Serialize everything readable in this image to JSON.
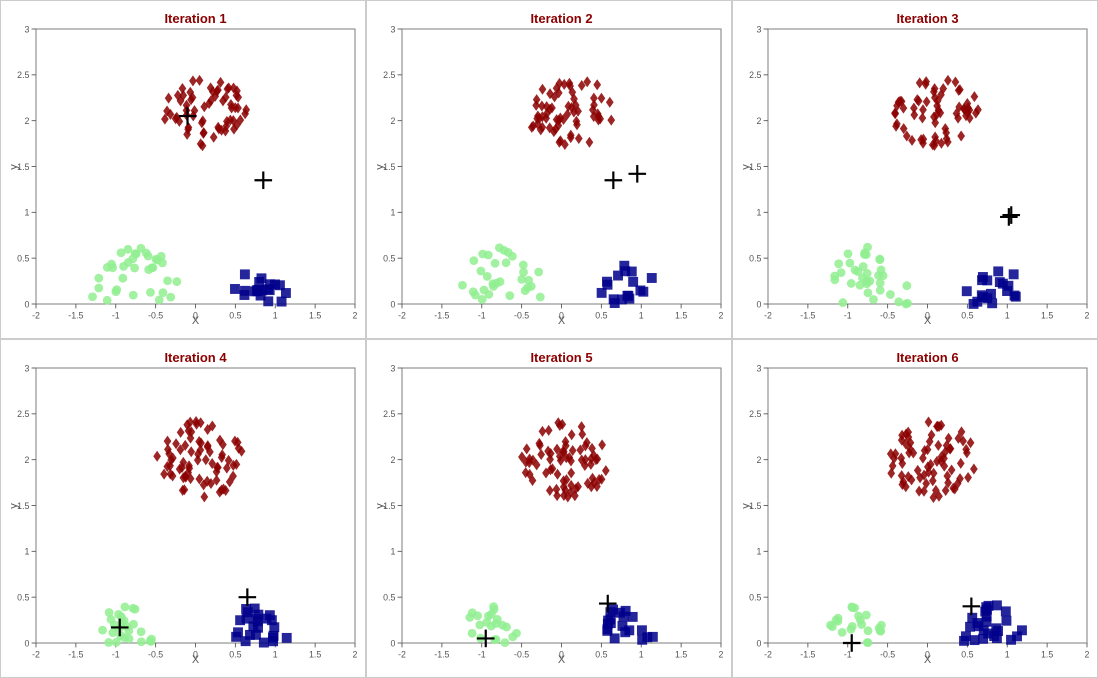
{
  "plots": [
    {
      "title": "Iteration 1",
      "id": 1
    },
    {
      "title": "Iteration 2",
      "id": 2
    },
    {
      "title": "Iteration 3",
      "id": 3
    },
    {
      "title": "Iteration 4",
      "id": 4
    },
    {
      "title": "Iteration 5",
      "id": 5
    },
    {
      "title": "Iteration 6",
      "id": 6
    }
  ],
  "axis": {
    "x_label": "X",
    "y_label": "y",
    "x_ticks": [
      "-2",
      "-1.5",
      "-1",
      "-0.5",
      "0",
      "0.5",
      "1",
      "1.5",
      "2"
    ],
    "y_ticks": [
      "0",
      "0.5",
      "1",
      "1.5",
      "2",
      "2.5",
      "3"
    ]
  },
  "colors": {
    "darkred": "#8B0000",
    "green": "#90EE90",
    "blue": "#00008B",
    "cross": "#000000"
  }
}
